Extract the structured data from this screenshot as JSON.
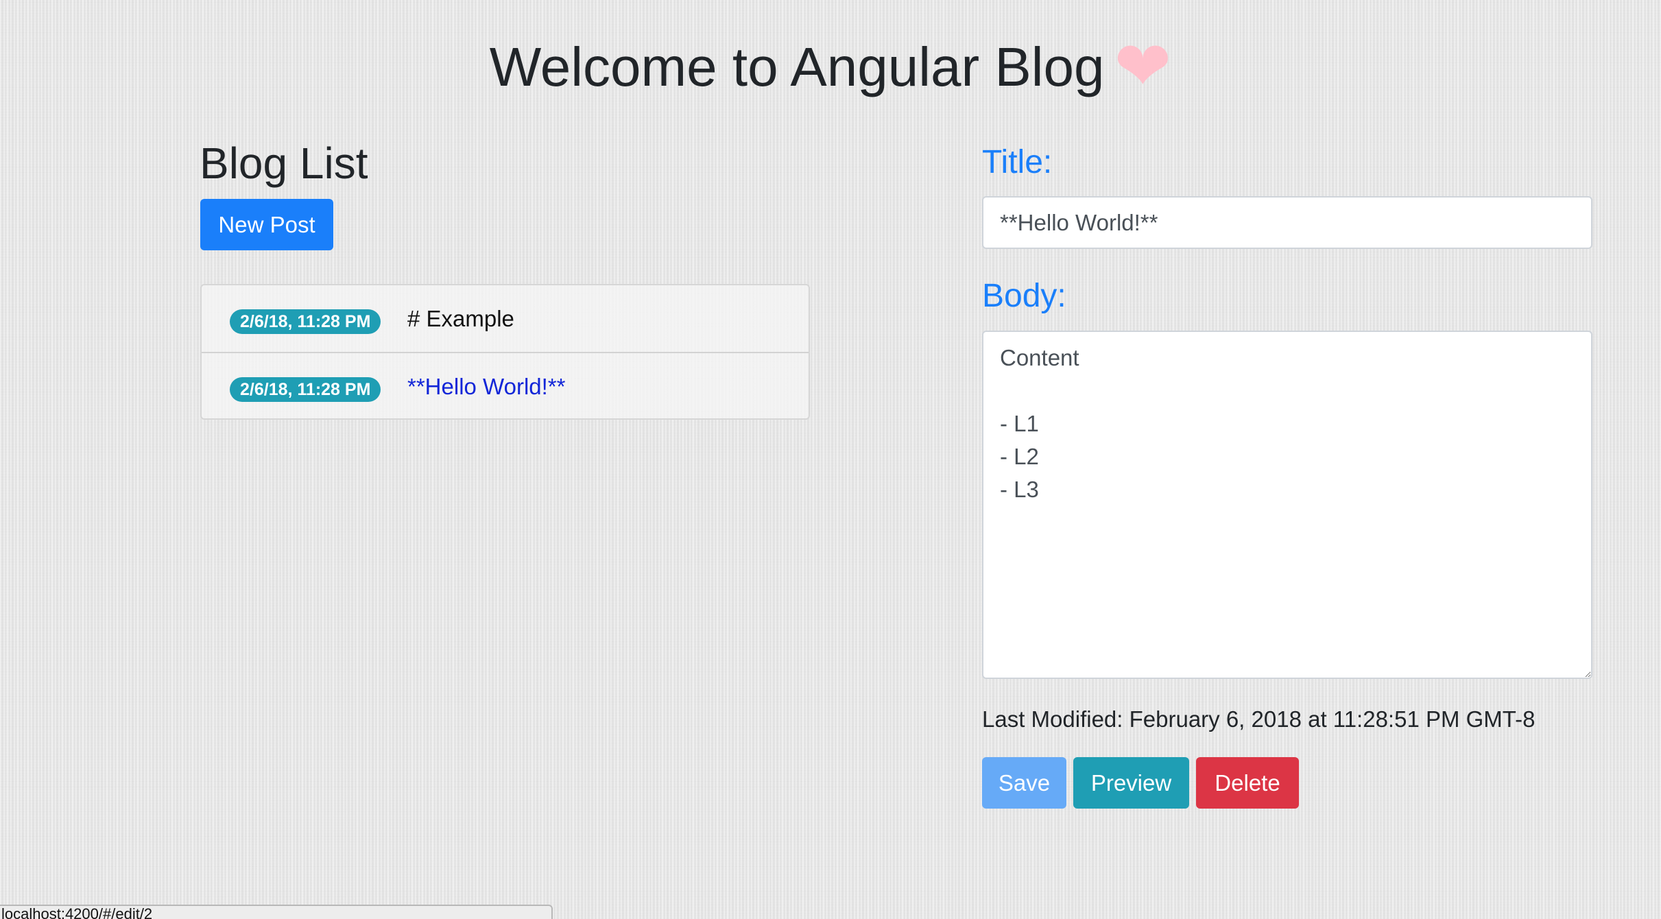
{
  "header": {
    "title": "Welcome to Angular Blog",
    "heart_icon": "heart-icon",
    "heart_glyph": "❤",
    "heart_color": "#ffc0cb"
  },
  "blog_list": {
    "heading": "Blog List",
    "new_post_label": "New Post",
    "items": [
      {
        "date": "2/6/18, 11:28 PM",
        "title": "# Example",
        "active": false
      },
      {
        "date": "2/6/18, 11:28 PM",
        "title": "**Hello World!**",
        "active": true
      }
    ]
  },
  "editor": {
    "title_label": "Title:",
    "title_value": "**Hello World!**",
    "body_label": "Body:",
    "body_value": "Content\n\n- L1\n- L2\n- L3",
    "last_modified": "Last Modified: February 6, 2018 at 11:28:51 PM GMT-8",
    "save_label": "Save",
    "preview_label": "Preview",
    "delete_label": "Delete"
  },
  "colors": {
    "primary": "#1a7ffa",
    "info": "#1f9eb4",
    "danger": "#dc3545",
    "save_disabled": "#66aaf7",
    "link_active": "#1226d8"
  },
  "status_bar": {
    "url": "localhost:4200/#/edit/2"
  }
}
